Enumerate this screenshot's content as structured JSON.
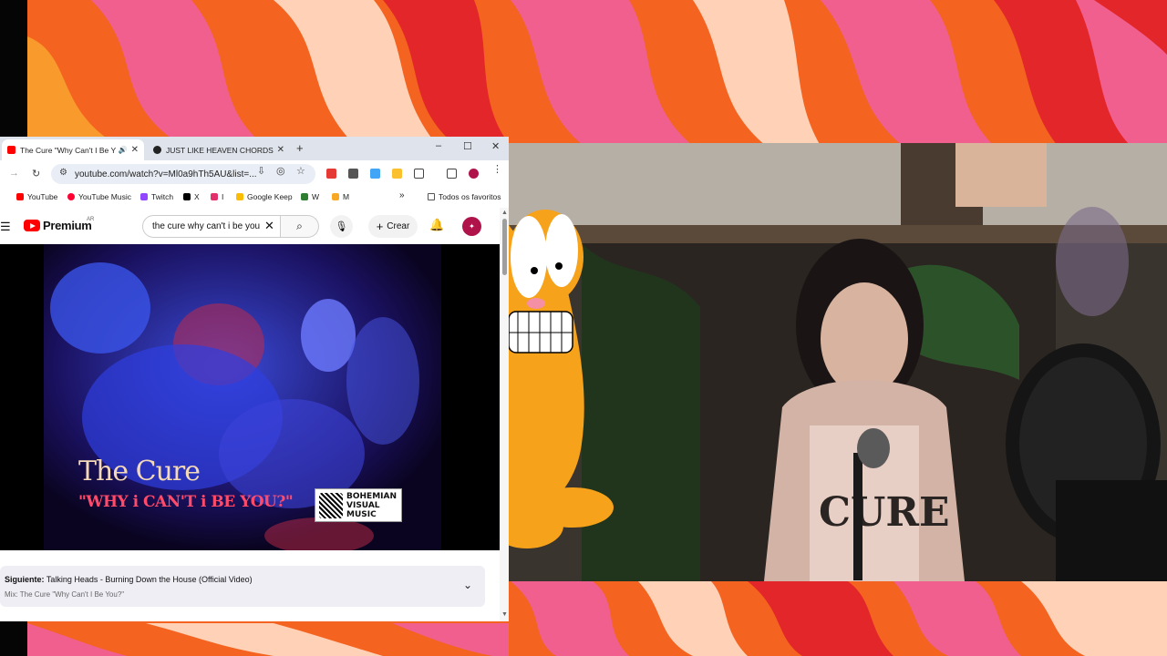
{
  "browser": {
    "tabs": [
      {
        "title": "The Cure \"Why Can't I Be Y",
        "audio": "🔊",
        "close": "✕",
        "active": true
      },
      {
        "title": "JUST LIKE HEAVEN CHORDS by",
        "close": "✕",
        "active": false
      }
    ],
    "new_tab": "+",
    "window_controls": {
      "minimize": "–",
      "maximize": "☐",
      "close": "✕"
    },
    "url": "youtube.com/watch?v=Ml0a9hTh5AU&list=...",
    "bookmarks": [
      {
        "label": "YouTube",
        "color": "#ff0000"
      },
      {
        "label": "YouTube Music",
        "color": "#ff0033"
      },
      {
        "label": "Twitch",
        "color": "#9146ff"
      },
      {
        "label": "X",
        "color": "#000000"
      },
      {
        "label": "I",
        "color": "#e1306c"
      },
      {
        "label": "Google Keep",
        "color": "#fbbc04"
      },
      {
        "label": "W",
        "color": "#2e7d32"
      },
      {
        "label": "M",
        "color": "#f9a825"
      }
    ],
    "bookmarks_more": "»",
    "all_favorites": "Todos os favoritos"
  },
  "youtube": {
    "logo_text": "Premium",
    "region": "AR",
    "search_value": "the cure why can't i be you",
    "create_label": "Crear",
    "avatar_initial": "✦",
    "video": {
      "overlay_title": "The Cure",
      "overlay_subtitle": "\"WHY i CAN'T i BE YOU?\"",
      "logo_lines": [
        "BOHEMIAN",
        "VISUAL",
        "MUSIC"
      ]
    },
    "up_next": {
      "label": "Siguiente:",
      "title": "Talking Heads - Burning Down the House (Official Video)",
      "mix": "Mix: The Cure \"Why Can't I Be You?\""
    }
  },
  "colors": {
    "bg_orange": "#f4631f",
    "bg_pink": "#f05f8e",
    "bg_red": "#e3262a",
    "garfield": "#f7a21b"
  }
}
